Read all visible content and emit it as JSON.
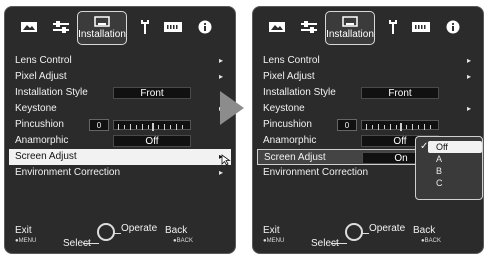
{
  "tabs": [
    {
      "icon": "picture-icon"
    },
    {
      "icon": "sliders-icon"
    },
    {
      "icon": "installation-icon",
      "label": "Installation"
    },
    {
      "icon": "wrench-icon"
    },
    {
      "icon": "hdmi-icon"
    },
    {
      "icon": "info-icon"
    }
  ],
  "menu_left": {
    "items": [
      {
        "label": "Lens Control",
        "arrow": "▸"
      },
      {
        "label": "Pixel Adjust",
        "arrow": "▸"
      },
      {
        "label": "Installation Style",
        "value": "Front"
      },
      {
        "label": "Keystone",
        "arrow": "▸"
      },
      {
        "label": "Pincushion",
        "value": "0"
      },
      {
        "label": "Anamorphic",
        "value": "Off"
      },
      {
        "label": "Screen Adjust",
        "arrow": "▸"
      },
      {
        "label": "Environment Correction",
        "arrow": "▸"
      }
    ]
  },
  "menu_right": {
    "items": [
      {
        "label": "Lens Control",
        "arrow": "▸"
      },
      {
        "label": "Pixel Adjust",
        "arrow": "▸"
      },
      {
        "label": "Installation Style",
        "value": "Front"
      },
      {
        "label": "Keystone",
        "arrow": "▸"
      },
      {
        "label": "Pincushion",
        "value": "0"
      },
      {
        "label": "Anamorphic",
        "value": "Off"
      },
      {
        "label": "Screen Adjust",
        "value": "On"
      },
      {
        "label": "Environment Correction"
      }
    ],
    "dropdown": [
      "Off",
      "A",
      "B",
      "C"
    ]
  },
  "footer": {
    "exit": "Exit",
    "exit_key": "●MENU",
    "select": "Select",
    "operate": "Operate",
    "back": "Back",
    "back_key": "●BACK"
  },
  "colors": {
    "panel": "#2b2b2b",
    "highlight": "#f2f2f2"
  }
}
